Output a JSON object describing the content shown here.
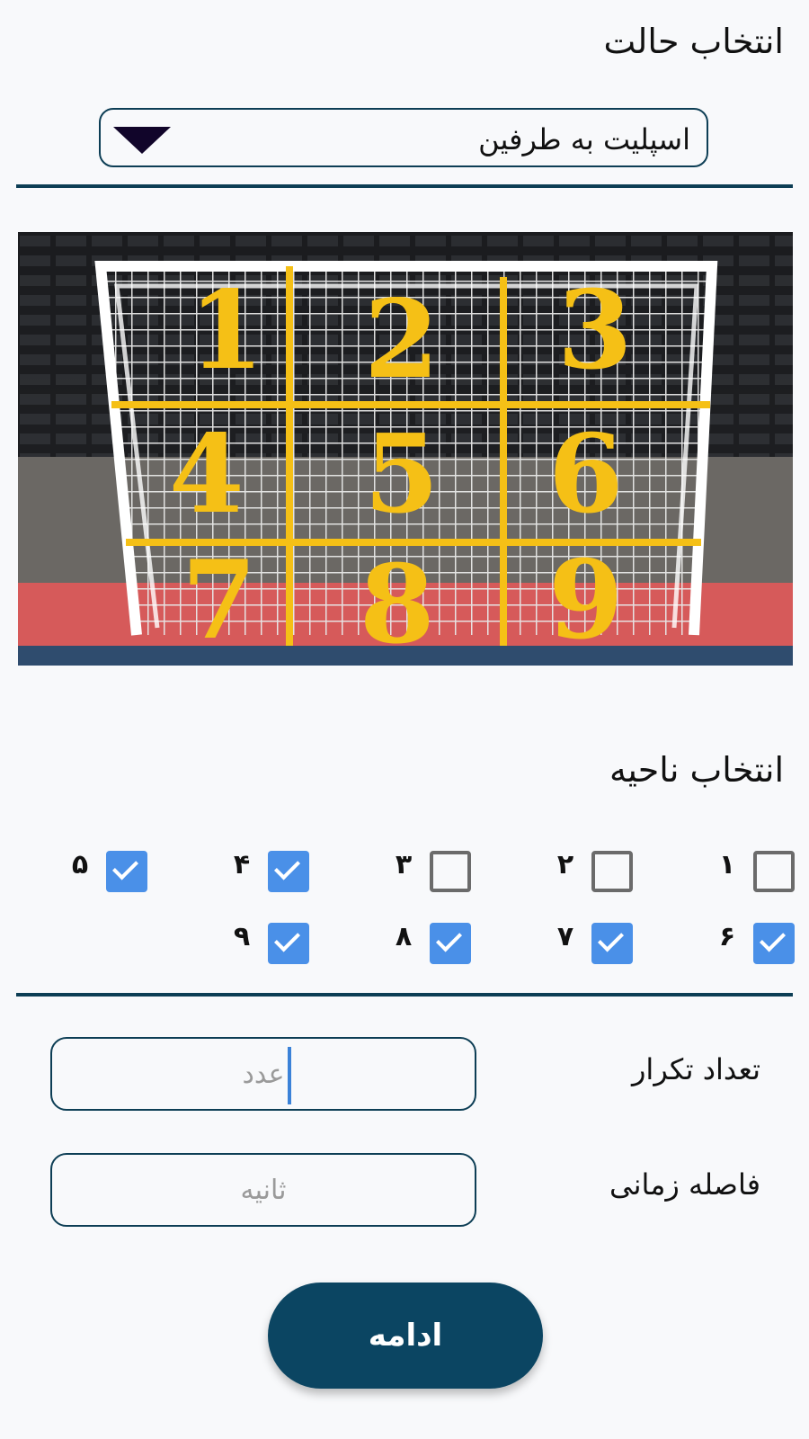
{
  "mode_section": {
    "title": "انتخاب حالت",
    "selected_mode": "اسپلیت به طرفین"
  },
  "goal_image": {
    "zone_numbers": [
      "1",
      "2",
      "3",
      "4",
      "5",
      "6",
      "7",
      "8",
      "9"
    ],
    "zone_color": "#f5c016"
  },
  "zone_section": {
    "title": "انتخاب ناحیه",
    "checkboxes": [
      {
        "label": "۱",
        "checked": false
      },
      {
        "label": "۲",
        "checked": false
      },
      {
        "label": "۳",
        "checked": false
      },
      {
        "label": "۴",
        "checked": true
      },
      {
        "label": "۵",
        "checked": true
      },
      {
        "label": "۶",
        "checked": true
      },
      {
        "label": "۷",
        "checked": true
      },
      {
        "label": "۸",
        "checked": true
      },
      {
        "label": "۹",
        "checked": true
      }
    ]
  },
  "repeat_field": {
    "label": "تعداد تکرار",
    "placeholder": "عدد",
    "value": ""
  },
  "interval_field": {
    "label": "فاصله زمانی",
    "placeholder": "ثانیه",
    "value": ""
  },
  "continue_button": {
    "label": "ادامه"
  },
  "colors": {
    "primary": "#0b4562",
    "checkbox_checked": "#4a90e8",
    "background": "#f8f9fb"
  }
}
